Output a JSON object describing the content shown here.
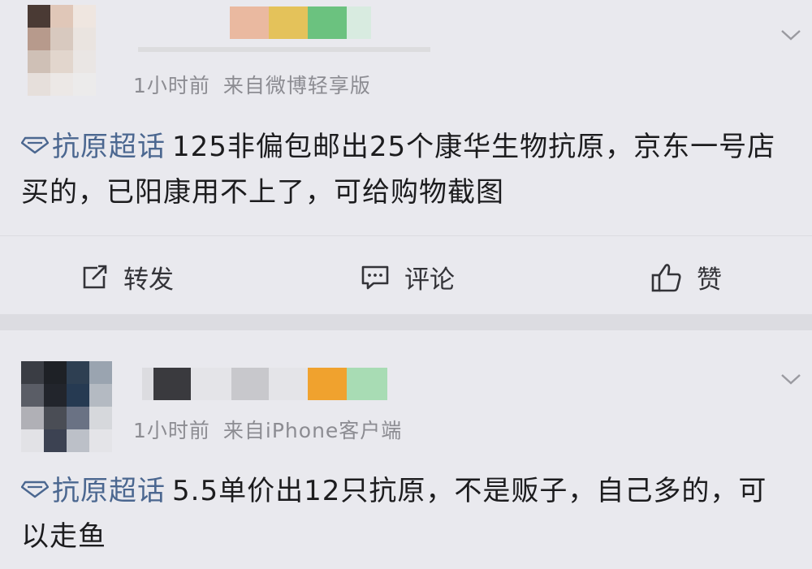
{
  "colors": {
    "topic_link": "#4b6790",
    "meta_text": "#8c8c92",
    "body_text": "#1c1c1e",
    "card_bg": "#e9e9ee"
  },
  "posts": [
    {
      "time": "1小时前",
      "source": "来自微博轻享版",
      "topic": "抗原超话",
      "text": "125非偏包邮出25个康华生物抗原，京东一号店买的，已阳康用不上了，可给购物截图",
      "icons": {
        "topic": "diamond-icon",
        "menu": "chevron-down-icon"
      },
      "actions": {
        "repost": {
          "label": "转发",
          "icon": "repost-icon"
        },
        "comment": {
          "label": "评论",
          "icon": "comment-icon"
        },
        "like": {
          "label": "赞",
          "icon": "thumbs-up-icon"
        }
      }
    },
    {
      "time": "1小时前",
      "source": "来自iPhone客户端",
      "topic": "抗原超话",
      "text": "5.5单价出12只抗原，不是贩子，自己多的，可以走鱼",
      "icons": {
        "topic": "diamond-icon",
        "menu": "chevron-down-icon"
      }
    }
  ]
}
